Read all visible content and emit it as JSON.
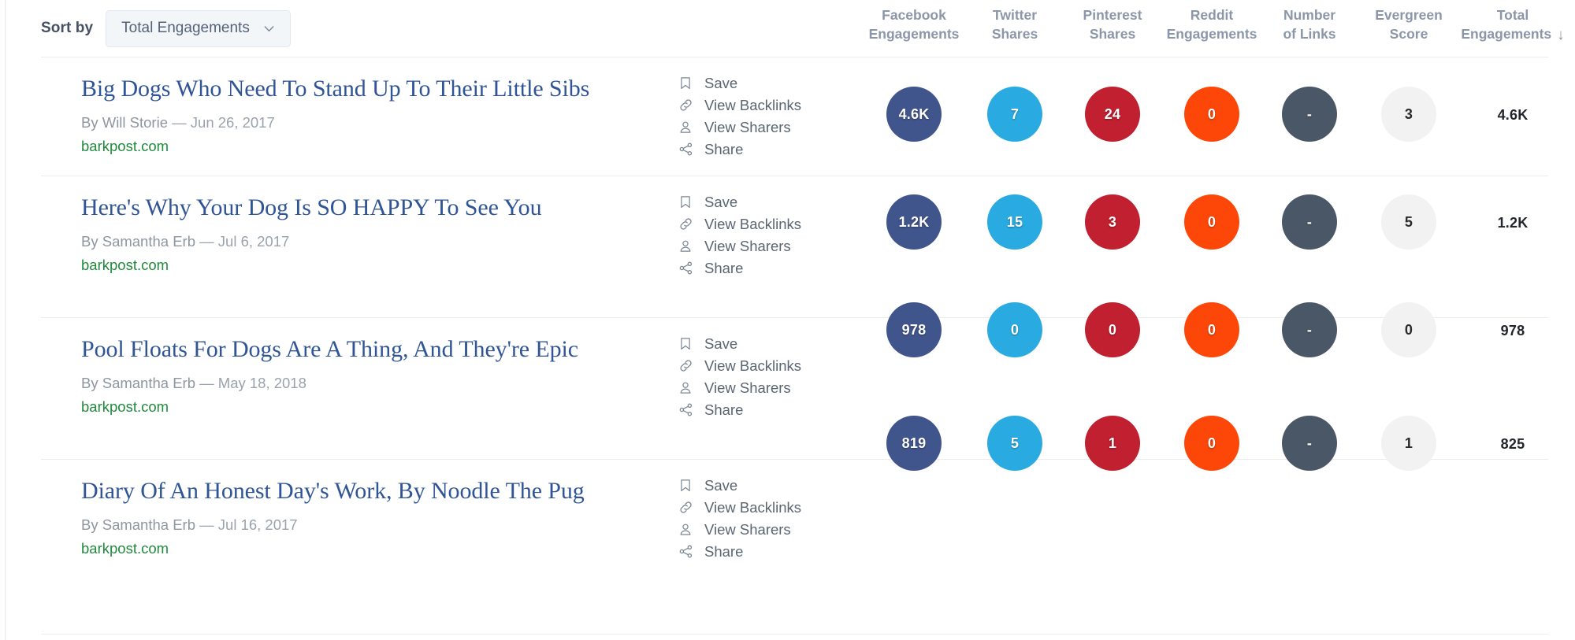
{
  "toolbar": {
    "sort_label": "Sort by",
    "sort_value": "Total Engagements",
    "chevron_icon": "chevron-down-icon"
  },
  "columns": [
    {
      "key": "facebook",
      "line1": "Facebook",
      "line2": "Engagements",
      "center": 1160,
      "color": "#41558d"
    },
    {
      "key": "twitter",
      "line1": "Twitter",
      "line2": "Shares",
      "center": 1288,
      "color": "#29abe2"
    },
    {
      "key": "pinterest",
      "line1": "Pinterest",
      "line2": "Shares",
      "center": 1412,
      "color": "#c02030"
    },
    {
      "key": "reddit",
      "line1": "Reddit",
      "line2": "Engagements",
      "center": 1538,
      "color": "#fc4709"
    },
    {
      "key": "links",
      "line1": "Number",
      "line2": "of Links",
      "center": 1662,
      "color": "#4a5767"
    },
    {
      "key": "evergreen",
      "line1": "Evergreen",
      "line2": "Score",
      "center": 1788,
      "color": "#f2f2f2"
    },
    {
      "key": "total",
      "line1": "Total",
      "line2": "Engagements",
      "center": 1920,
      "color": "#22262b",
      "sorted": true,
      "sort_arrow": "↓"
    }
  ],
  "row_actions": [
    {
      "icon": "bookmark-icon",
      "label": "Save"
    },
    {
      "icon": "link-icon",
      "label": "View Backlinks"
    },
    {
      "icon": "person-icon",
      "label": "View Sharers"
    },
    {
      "icon": "share-icon",
      "label": "Share"
    }
  ],
  "rows": [
    {
      "title": "Big Dogs Who Need To Stand Up To Their Little Sibs",
      "author": "By Will Storie",
      "separator": "—",
      "date": "Jun 26, 2017",
      "domain": "barkpost.com",
      "metrics": {
        "facebook": "4.6K",
        "twitter": "7",
        "pinterest": "24",
        "reddit": "0",
        "links": "-",
        "evergreen": "3",
        "total": "4.6K"
      }
    },
    {
      "title": "Here's Why Your Dog Is SO HAPPY To See You",
      "author": "By Samantha Erb",
      "separator": "—",
      "date": "Jul 6, 2017",
      "domain": "barkpost.com",
      "metrics": {
        "facebook": "1.2K",
        "twitter": "15",
        "pinterest": "3",
        "reddit": "0",
        "links": "-",
        "evergreen": "5",
        "total": "1.2K"
      }
    },
    {
      "title": "Pool Floats For Dogs Are A Thing, And They're Epic",
      "author": "By Samantha Erb",
      "separator": "—",
      "date": "May 18, 2018",
      "domain": "barkpost.com",
      "metrics": {
        "facebook": "978",
        "twitter": "0",
        "pinterest": "0",
        "reddit": "0",
        "links": "-",
        "evergreen": "0",
        "total": "978"
      }
    },
    {
      "title": "Diary Of An Honest Day's Work, By Noodle The Pug",
      "author": "By Samantha Erb",
      "separator": "—",
      "date": "Jul 16, 2017",
      "domain": "barkpost.com",
      "metrics": {
        "facebook": "819",
        "twitter": "5",
        "pinterest": "1",
        "reddit": "0",
        "links": "-",
        "evergreen": "1",
        "total": "825"
      }
    }
  ]
}
